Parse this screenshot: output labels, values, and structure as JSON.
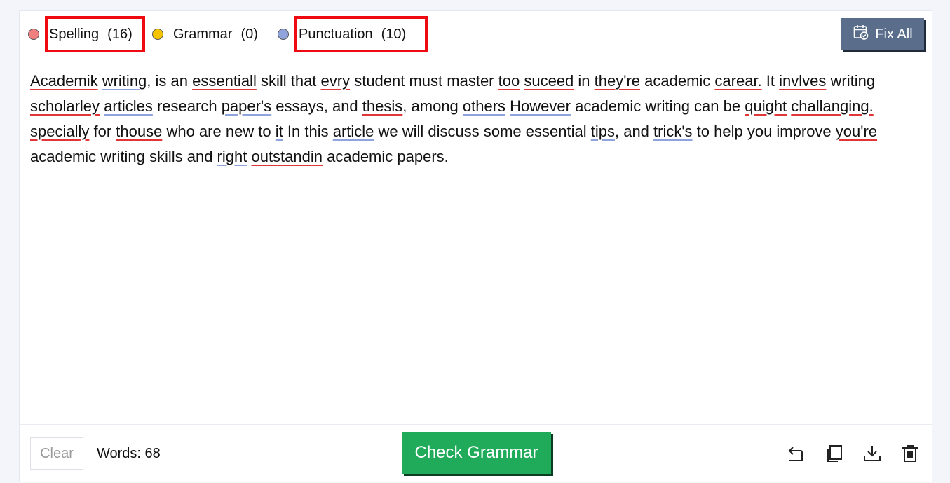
{
  "toolbar": {
    "categories": [
      {
        "label": "Spelling",
        "count": "(16)",
        "dot_color": "#f07f7f"
      },
      {
        "label": "Grammar",
        "count": "(0)",
        "dot_color": "#f5c400"
      },
      {
        "label": "Punctuation",
        "count": "(10)",
        "dot_color": "#8fa3dd"
      }
    ],
    "fix_all_label": "Fix All",
    "fix_all_icon": "calendar-check-icon"
  },
  "colors": {
    "spelling_underline": "#e0363a",
    "punctuation_underline": "#8fa3dd",
    "highlight_box": "#ee0a10",
    "fix_all_bg": "#5a6e8c",
    "check_grammar_bg": "#1fab5a"
  },
  "editor": {
    "tokens": [
      {
        "t": "Academik",
        "m": "sp"
      },
      {
        "t": " "
      },
      {
        "t": "writing",
        "m": "pu"
      },
      {
        "t": ", is an "
      },
      {
        "t": "essentiall",
        "m": "sp"
      },
      {
        "t": " skill that "
      },
      {
        "t": "evry",
        "m": "sp"
      },
      {
        "t": " student must master "
      },
      {
        "t": "too",
        "m": "sp"
      },
      {
        "t": " "
      },
      {
        "t": "suceed",
        "m": "sp"
      },
      {
        "t": " in "
      },
      {
        "t": "they're",
        "m": "sp"
      },
      {
        "t": " academic "
      },
      {
        "t": "carear.",
        "m": "sp"
      },
      {
        "t": " It "
      },
      {
        "t": "invlves",
        "m": "sp"
      },
      {
        "t": " writing "
      },
      {
        "t": "scholarley",
        "m": "sp"
      },
      {
        "t": " "
      },
      {
        "t": "articles",
        "m": "pu"
      },
      {
        "t": " research "
      },
      {
        "t": "paper's",
        "m": "pu"
      },
      {
        "t": " essays, and "
      },
      {
        "t": "thesis",
        "m": "sp"
      },
      {
        "t": ", among "
      },
      {
        "t": "others",
        "m": "pu"
      },
      {
        "t": " "
      },
      {
        "t": "However",
        "m": "pu"
      },
      {
        "t": " academic writing can be "
      },
      {
        "t": "quight",
        "m": "sp"
      },
      {
        "t": " "
      },
      {
        "t": "challanging.",
        "m": "sp"
      },
      {
        "t": " "
      },
      {
        "t": "specially",
        "m": "sp"
      },
      {
        "t": " for "
      },
      {
        "t": "thouse",
        "m": "sp"
      },
      {
        "t": " who are new to "
      },
      {
        "t": "it",
        "m": "pu"
      },
      {
        "t": " In this "
      },
      {
        "t": "article",
        "m": "pu"
      },
      {
        "t": " we will discuss some essential "
      },
      {
        "t": "tips",
        "m": "pu"
      },
      {
        "t": ", and "
      },
      {
        "t": "trick's",
        "m": "pu"
      },
      {
        "t": " to help you improve "
      },
      {
        "t": "you're",
        "m": "sp"
      },
      {
        "t": " academic writing skills and "
      },
      {
        "t": "right",
        "m": "pu"
      },
      {
        "t": " "
      },
      {
        "t": "outstandin",
        "m": "sp"
      },
      {
        "t": " academic papers."
      }
    ]
  },
  "footer": {
    "clear_label": "Clear",
    "words_label": "Words: 68",
    "check_label": "Check Grammar",
    "tools": [
      "undo-icon",
      "copy-icon",
      "download-icon",
      "trash-icon"
    ]
  }
}
